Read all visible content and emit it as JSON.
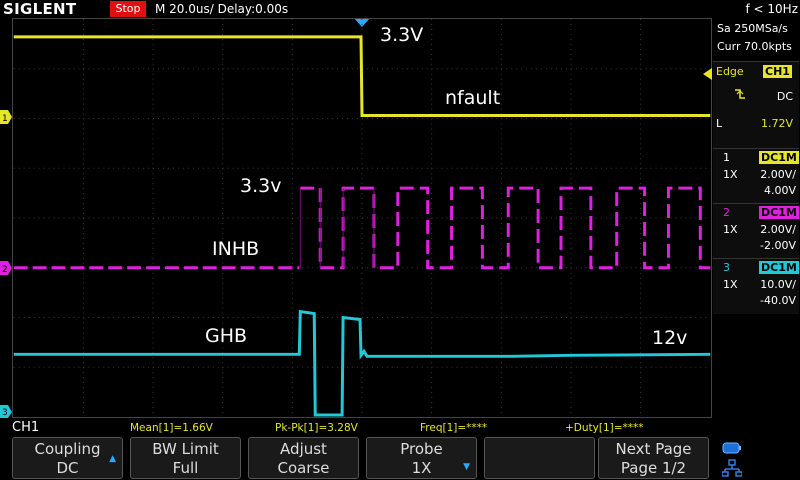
{
  "header": {
    "brand": "SIGLENT",
    "status": "Stop",
    "timebase": "M 20.0us/  Delay:0.00s",
    "frequency": "f < 10Hz"
  },
  "acquisition": {
    "sample_rate": "Sa 250MSa/s",
    "memory": "Curr 70.0kpts"
  },
  "trigger": {
    "type": "Edge",
    "source": "CH1",
    "coupling": "DC",
    "level_label": "L",
    "level": "1.72V"
  },
  "channels": [
    {
      "num": "1",
      "coupling": "DC1M",
      "probe": "1X",
      "scale": "2.00V/",
      "offset": "4.00V",
      "color": "#e6e629"
    },
    {
      "num": "2",
      "coupling": "DC1M",
      "probe": "1X",
      "scale": "2.00V/",
      "offset": "-2.00V",
      "color": "#e020e0"
    },
    {
      "num": "3",
      "coupling": "DC1M",
      "probe": "1X",
      "scale": "10.0V/",
      "offset": "-40.0V",
      "color": "#20c8d8"
    }
  ],
  "annotations": {
    "ch1_high": "3.3V",
    "ch1_name": "nfault",
    "ch2_high": "3.3v",
    "ch2_name": "INHB",
    "ch3_name": "GHB",
    "ch3_level": "12v"
  },
  "measurements": {
    "channel": "CH1",
    "mean": "Mean[1]=1.66V",
    "pkpk": "Pk-Pk[1]=3.28V",
    "freq": "Freq[1]=****",
    "duty": "+Duty[1]=****"
  },
  "softkeys": [
    {
      "label": "Coupling",
      "value": "DC",
      "arrow": "up"
    },
    {
      "label": "BW Limit",
      "value": "Full",
      "arrow": ""
    },
    {
      "label": "Adjust",
      "value": "Coarse",
      "arrow": ""
    },
    {
      "label": "Probe",
      "value": "1X",
      "arrow": "down"
    },
    {
      "label": "",
      "value": "",
      "arrow": ""
    },
    {
      "label": "Next Page",
      "value": "Page 1/2",
      "arrow": ""
    }
  ]
}
